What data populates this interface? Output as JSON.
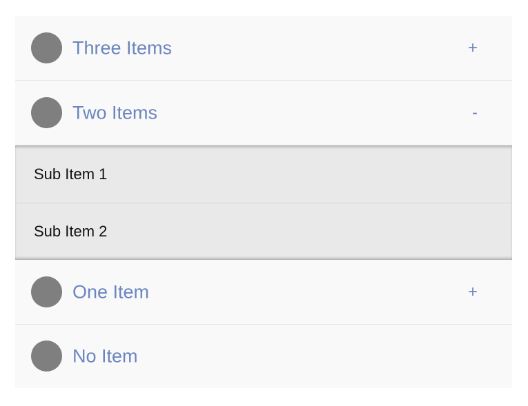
{
  "accordion": {
    "items": [
      {
        "title": "Three Items",
        "toggle": "+"
      },
      {
        "title": "Two Items",
        "toggle": "-",
        "sub_items": [
          {
            "label": "Sub Item 1"
          },
          {
            "label": "Sub Item 2"
          }
        ]
      },
      {
        "title": "One Item",
        "toggle": "+"
      },
      {
        "title": "No Item"
      }
    ]
  },
  "colors": {
    "title_text": "#6c85c0",
    "row_background": "#f9f9f9",
    "sub_background": "#e9e9e9",
    "avatar": "#7f7f7f"
  }
}
